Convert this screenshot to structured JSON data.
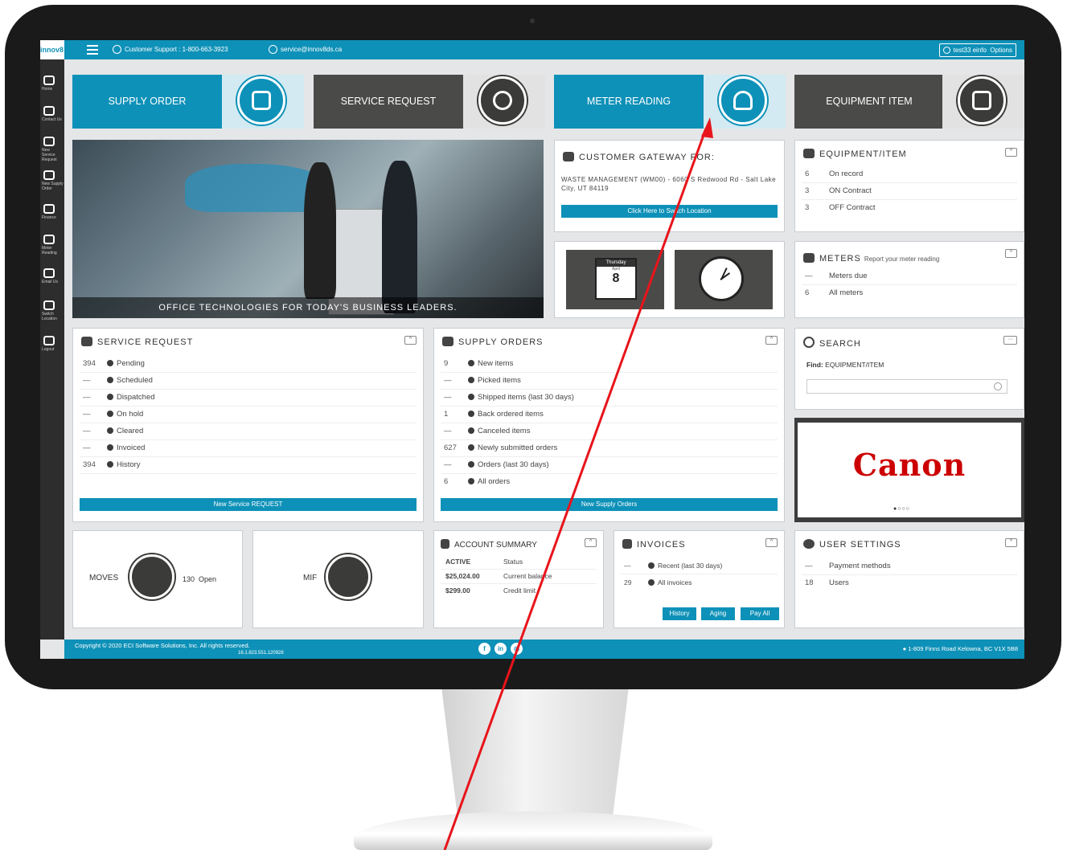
{
  "topbar": {
    "logo": "innov8",
    "support": "Customer Support : 1-800-663-3923",
    "email": "service@innov8ds.ca",
    "user": "test33 einfo",
    "options": "Options"
  },
  "sidebar": [
    {
      "label": "Home",
      "icon": "home-icon"
    },
    {
      "label": "Contact Us",
      "icon": "contact-icon"
    },
    {
      "label": "New Service Request",
      "icon": "service-icon"
    },
    {
      "label": "New Supply Order",
      "icon": "supply-icon"
    },
    {
      "label": "Finance",
      "icon": "finance-icon"
    },
    {
      "label": "Meter Reading",
      "icon": "meter-icon"
    },
    {
      "label": "Email Us",
      "icon": "mail-icon"
    },
    {
      "label": "Switch Location",
      "icon": "switch-icon"
    },
    {
      "label": "Logout",
      "icon": "logout-icon"
    }
  ],
  "tiles": {
    "supply_order": "SUPPLY ORDER",
    "service_request": "SERVICE REQUEST",
    "meter_reading": "METER READING",
    "equipment_item": "EQUIPMENT ITEM"
  },
  "hero": {
    "caption": "OFFICE TECHNOLOGIES FOR TODAY'S BUSINESS LEADERS."
  },
  "gateway": {
    "title": "CUSTOMER GATEWAY FOR:",
    "address": "WASTE MANAGEMENT (WM00) - 6060 S Redwood Rd - Salt Lake City, UT 84119",
    "button": "Click Here to Switch Location"
  },
  "calendar": {
    "day": "Thursday",
    "month": "April",
    "date": "8"
  },
  "equipment": {
    "title": "EQUIPMENT/ITEM",
    "rows": [
      {
        "n": "6",
        "label": "On record"
      },
      {
        "n": "3",
        "label": "ON Contract"
      },
      {
        "n": "3",
        "label": "OFF Contract"
      }
    ]
  },
  "meters": {
    "title": "METERS",
    "subtitle": "Report your meter reading",
    "rows": [
      {
        "n": "—",
        "label": "Meters due"
      },
      {
        "n": "6",
        "label": "All meters"
      }
    ]
  },
  "service": {
    "title": "SERVICE REQUEST",
    "rows": [
      {
        "n": "394",
        "label": "Pending"
      },
      {
        "n": "—",
        "label": "Scheduled"
      },
      {
        "n": "—",
        "label": "Dispatched"
      },
      {
        "n": "—",
        "label": "On hold"
      },
      {
        "n": "—",
        "label": "Cleared"
      },
      {
        "n": "—",
        "label": "Invoiced"
      },
      {
        "n": "394",
        "label": "History"
      }
    ],
    "button": "New Service REQUEST"
  },
  "supply": {
    "title": "SUPPLY ORDERS",
    "rows": [
      {
        "n": "9",
        "label": "New items"
      },
      {
        "n": "—",
        "label": "Picked items"
      },
      {
        "n": "—",
        "label": "Shipped items (last 30 days)"
      },
      {
        "n": "1",
        "label": "Back ordered items"
      },
      {
        "n": "—",
        "label": "Canceled items"
      },
      {
        "n": "627",
        "label": "Newly submitted orders"
      },
      {
        "n": "—",
        "label": "Orders (last 30 days)"
      },
      {
        "n": "6",
        "label": "All orders"
      }
    ],
    "button": "New Supply Orders"
  },
  "search": {
    "title": "SEARCH",
    "find_label": "Find:",
    "find_value": "EQUIPMENT/ITEM"
  },
  "banner": {
    "brand": "Canon"
  },
  "moves": {
    "label": "MOVES",
    "count": "130",
    "status": "Open"
  },
  "mif": {
    "label": "MIF"
  },
  "account": {
    "title": "ACCOUNT SUMMARY",
    "rows": [
      {
        "value": "ACTIVE",
        "label": "Status"
      },
      {
        "value": "$25,024.00",
        "label": "Current balance"
      },
      {
        "value": "$299.00",
        "label": "Credit limit"
      }
    ]
  },
  "invoices": {
    "title": "INVOICES",
    "rows": [
      {
        "n": "—",
        "label": "Recent (last 30 days)"
      },
      {
        "n": "29",
        "label": "All invoices"
      }
    ],
    "buttons": [
      "History",
      "Aging",
      "Pay All"
    ]
  },
  "user_settings": {
    "title": "USER SETTINGS",
    "rows": [
      {
        "n": "—",
        "label": "Payment methods"
      },
      {
        "n": "18",
        "label": "Users"
      }
    ]
  },
  "footer": {
    "copyright": "Copyright © 2020 ECI Software Solutions, Inc. All rights reserved.",
    "version": "16.1.823.551.120928",
    "address": "1-809 Finns Road Kelowna, BC V1X 5B8"
  },
  "colors": {
    "accent": "#0e91b8",
    "dark_tile": "#4a4a48",
    "arrow": "#e8141b",
    "canon_red": "#cc0000"
  }
}
